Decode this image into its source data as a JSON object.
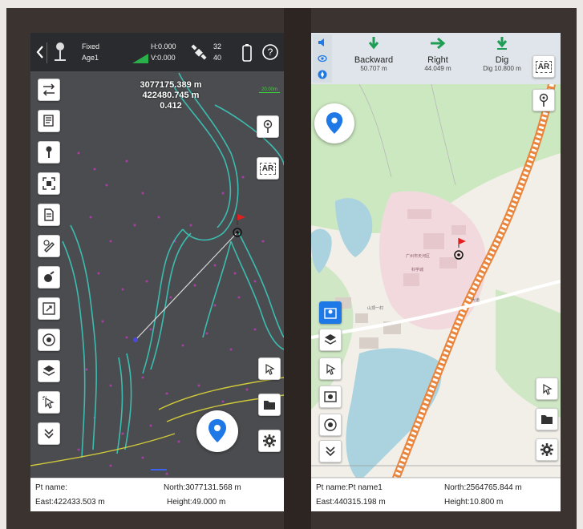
{
  "left": {
    "status": {
      "mode": "Fixed",
      "age": "Age1",
      "h_precision": "H:0.000",
      "v_precision": "V:0.000",
      "satellites_used": "32",
      "satellites_total": "40"
    },
    "coords": {
      "north": "3077175.389 m",
      "east": "422480.745 m",
      "distance": "0.412"
    },
    "scale_label": "20.00m",
    "toolbar_icons": [
      "transfer-icon",
      "layers-book-icon",
      "survey-pole-icon",
      "focus-icon",
      "document-icon",
      "pen-icon",
      "paint-icon",
      "zoom-extent-icon",
      "target-icon",
      "layers-icon",
      "select-arrow-icon",
      "chevron-double-down-icon"
    ],
    "right_icons": [
      "survey-pole-icon",
      "ar-icon"
    ],
    "bottom_right_icons": [
      "select-arrow-icon",
      "folder-icon",
      "gear-icon"
    ],
    "ar_label": "AR",
    "bottom": {
      "pt_name": "Pt name:",
      "north": "North:3077131.568 m",
      "east": "East:422433.503 m",
      "height": "Height:49.000 m"
    }
  },
  "right": {
    "nav": [
      {
        "label": "Backward",
        "value": "50.707 m",
        "arrow": "down"
      },
      {
        "label": "Right",
        "value": "44.049 m",
        "arrow": "right"
      },
      {
        "label": "Dig",
        "value": "Dig 10.800 m",
        "arrow": "dig"
      }
    ],
    "side_icons": [
      "speaker-icon",
      "visibility-icon",
      "compass-icon"
    ],
    "ar_label": "AR",
    "map_labels": [
      "广州市天河区",
      "科学城",
      "山顶一村",
      "大道"
    ],
    "toolbar_icons": [
      "map-point-icon",
      "layers-icon",
      "select-arrow-icon",
      "camera-target-icon",
      "target-icon",
      "chevron-double-down-icon"
    ],
    "bottom_right_icons": [
      "select-arrow-icon",
      "folder-icon",
      "gear-icon"
    ],
    "bottom": {
      "pt_name": "Pt name:Pt name1",
      "north": "North:2564765.844 m",
      "east": "East:440315.198 m",
      "height": "Height:10.800 m"
    }
  },
  "colors": {
    "accent": "#1e78e6",
    "nav_green": "#1f9d55",
    "flag_red": "#e02020",
    "road_orange": "#e9853d"
  }
}
